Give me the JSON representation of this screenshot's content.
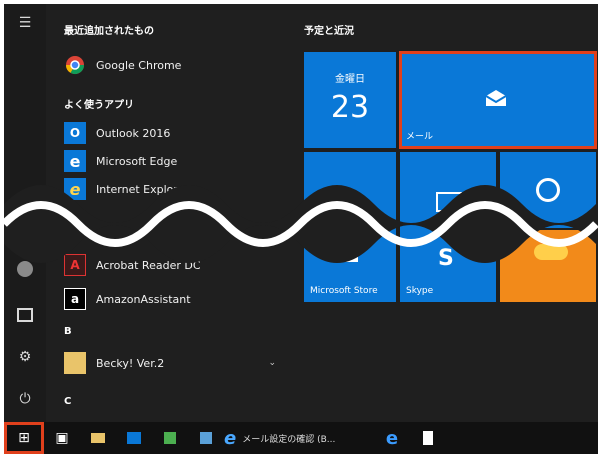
{
  "list": {
    "recent_header": "最近追加されたもの",
    "frequent_header": "よく使うアプリ",
    "section_b": "B",
    "section_c": "C",
    "apps": {
      "chrome": "Google Chrome",
      "outlook": "Outlook 2016",
      "edge": "Microsoft Edge",
      "ie": "Internet Explorer",
      "acrobat": "Acrobat Reader DC",
      "amazon": "AmazonAssistant",
      "becky": "Becky! Ver.2"
    },
    "outlook_icon_text": "O",
    "amazon_icon_text": "a"
  },
  "tiles": {
    "group_header": "予定と近況",
    "calendar": {
      "day": "金曜日",
      "date": "23"
    },
    "mail_label": "メール",
    "store_label": "Microsoft Store",
    "skype_label": "Skype"
  },
  "taskbar": {
    "window_title": "メール設定の確認 (B..."
  },
  "colors": {
    "tile_blue": "#0a78d7",
    "highlight_red": "#e0401c",
    "background": "#1f1f1f"
  }
}
